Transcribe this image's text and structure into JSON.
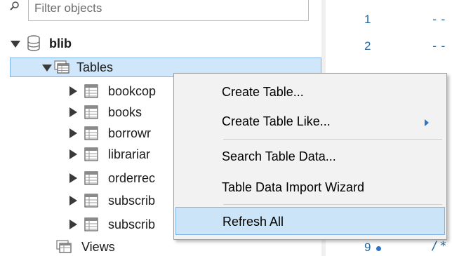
{
  "filter": {
    "placeholder": "Filter objects"
  },
  "tree": {
    "schema": {
      "label": "blib"
    },
    "tables_node": {
      "label": "Tables"
    },
    "tables": [
      {
        "label": "bookcop"
      },
      {
        "label": "books"
      },
      {
        "label": "borrowr"
      },
      {
        "label": "librariar"
      },
      {
        "label": "orderrec"
      },
      {
        "label": "subscrib"
      },
      {
        "label": "subscrib"
      }
    ],
    "views_node": {
      "label": "Views"
    }
  },
  "editor": {
    "lines": [
      {
        "num": "1",
        "text": "--"
      },
      {
        "num": "2",
        "text": "--"
      },
      {
        "num": "9",
        "text": "/*"
      }
    ]
  },
  "context_menu": {
    "items": [
      {
        "label": "Create Table..."
      },
      {
        "label": "Create Table Like...",
        "has_submenu": true
      },
      {
        "label": "Search Table Data..."
      },
      {
        "label": "Table Data Import Wizard"
      },
      {
        "label": "Refresh All",
        "highlighted": true
      }
    ]
  },
  "colors": {
    "selection_bg": "#cfe6fb",
    "selection_border": "#7eb4ea",
    "menu_bg": "#f2f2f2",
    "editor_text": "#2468a0"
  }
}
